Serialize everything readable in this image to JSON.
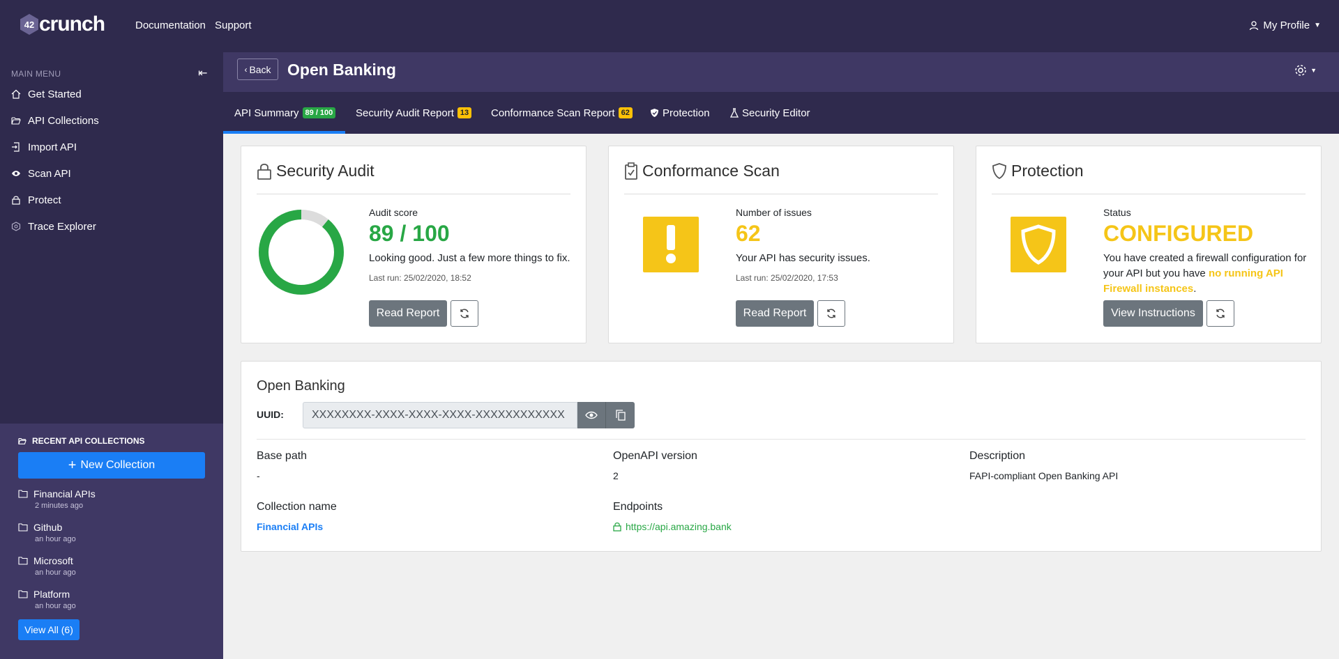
{
  "brand": {
    "logo_text": "crunch",
    "logo_badge": "42"
  },
  "topnav": {
    "documentation": "Documentation",
    "support": "Support",
    "profile": "My Profile"
  },
  "sidebar": {
    "menu_title": "MAIN MENU",
    "items": [
      {
        "label": "Get Started",
        "icon": "home-icon"
      },
      {
        "label": "API Collections",
        "icon": "folder-open-icon"
      },
      {
        "label": "Import API",
        "icon": "import-icon"
      },
      {
        "label": "Scan API",
        "icon": "eye-icon"
      },
      {
        "label": "Protect",
        "icon": "lock-icon"
      },
      {
        "label": "Trace Explorer",
        "icon": "trace-icon"
      }
    ],
    "recent_title": "RECENT API COLLECTIONS",
    "new_collection": "New Collection",
    "collections": [
      {
        "name": "Financial APIs",
        "time": "2 minutes ago"
      },
      {
        "name": "Github",
        "time": "an hour ago"
      },
      {
        "name": "Microsoft",
        "time": "an hour ago"
      },
      {
        "name": "Platform",
        "time": "an hour ago"
      }
    ],
    "view_all": "View All (6)"
  },
  "header": {
    "back": "Back",
    "title": "Open Banking"
  },
  "tabs": [
    {
      "label": "API Summary",
      "badge": "89 / 100"
    },
    {
      "label": "Security Audit Report",
      "badge": "13"
    },
    {
      "label": "Conformance Scan Report",
      "badge": "62"
    },
    {
      "label": "Protection"
    },
    {
      "label": "Security Editor"
    }
  ],
  "audit": {
    "title": "Security Audit",
    "score_label": "Audit score",
    "score": "89 / 100",
    "score_fraction": 0.89,
    "message": "Looking good. Just a few more things to fix.",
    "last_run": "Last run: 25/02/2020, 18:52",
    "button": "Read Report"
  },
  "scan": {
    "title": "Conformance Scan",
    "issues_label": "Number of issues",
    "issues": "62",
    "message": "Your API has security issues.",
    "last_run": "Last run: 25/02/2020, 17:53",
    "button": "Read Report"
  },
  "protection": {
    "title": "Protection",
    "status_label": "Status",
    "status": "CONFIGURED",
    "message_1": "You have created a firewall configuration for your API but you have ",
    "message_highlight": "no running API Firewall instances",
    "message_2": ".",
    "button": "View Instructions"
  },
  "info": {
    "title": "Open Banking",
    "uuid_label": "UUID:",
    "uuid_value": "XXXXXXXX-XXXX-XXXX-XXXX-XXXXXXXXXXXX",
    "base_path_label": "Base path",
    "base_path": "-",
    "openapi_label": "OpenAPI version",
    "openapi": "2",
    "description_label": "Description",
    "description": "FAPI-compliant Open Banking API",
    "collection_label": "Collection name",
    "collection": "Financial APIs",
    "endpoints_label": "Endpoints",
    "endpoint": "https://api.amazing.bank"
  },
  "colors": {
    "nav": "#2f2a4d",
    "accent": "#1a7ef5",
    "success": "#28a745",
    "warning": "#f5c518"
  }
}
